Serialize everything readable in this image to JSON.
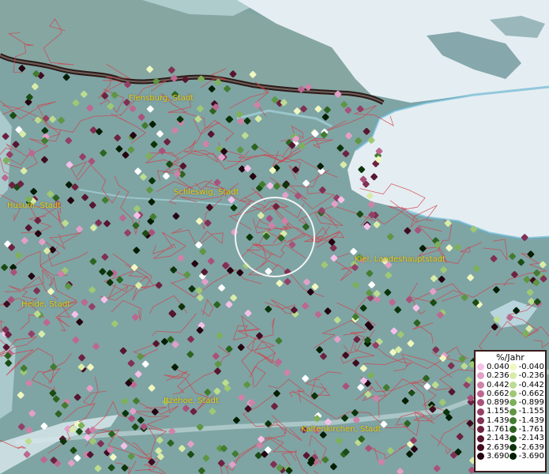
{
  "map": {
    "land_color": "#7fa4a4",
    "water_color": "#e4eef2",
    "boundary_color": "#d2404a",
    "coast_line_color": "#1a1414",
    "highlight_circle_color": "#f4f4f4",
    "cities": [
      {
        "name": "Flensburg, Stadt"
      },
      {
        "name": "Husum, Stadt"
      },
      {
        "name": "Schleswig, Stadt"
      },
      {
        "name": "Kiel, Landeshauptstadt"
      },
      {
        "name": "Heide, Stadt"
      },
      {
        "name": "Itzehoe, Stadt"
      },
      {
        "name": "Kaltenkirchen, Stadt"
      }
    ]
  },
  "legend": {
    "title": "%/Jahr",
    "positive": [
      {
        "label": "0.040",
        "color": "#f5c0e8"
      },
      {
        "label": "0.236",
        "color": "#e2a0c8"
      },
      {
        "label": "0.442",
        "color": "#cf82a8"
      },
      {
        "label": "0.662",
        "color": "#bc6890"
      },
      {
        "label": "0.899",
        "color": "#a8527a"
      },
      {
        "label": "1.155",
        "color": "#944066"
      },
      {
        "label": "1.439",
        "color": "#803052"
      },
      {
        "label": "1.761",
        "color": "#6c2240"
      },
      {
        "label": "2.143",
        "color": "#561630"
      },
      {
        "label": "2.639",
        "color": "#400c20"
      },
      {
        "label": "3.690",
        "color": "#240410"
      }
    ],
    "negative": [
      {
        "label": "-0.040",
        "color": "#f0f8c0"
      },
      {
        "label": "-0.236",
        "color": "#d8eca8"
      },
      {
        "label": "-0.442",
        "color": "#bcdc90"
      },
      {
        "label": "-0.662",
        "color": "#9ec874"
      },
      {
        "label": "-0.899",
        "color": "#7eb05a"
      },
      {
        "label": "-1.155",
        "color": "#5e9644"
      },
      {
        "label": "-1.439",
        "color": "#427c30"
      },
      {
        "label": "-1.761",
        "color": "#2c6420"
      },
      {
        "label": "-2.143",
        "color": "#1a4c14"
      },
      {
        "label": "-2.639",
        "color": "#0c340a"
      },
      {
        "label": "-3.690",
        "color": "#041e04"
      }
    ]
  }
}
